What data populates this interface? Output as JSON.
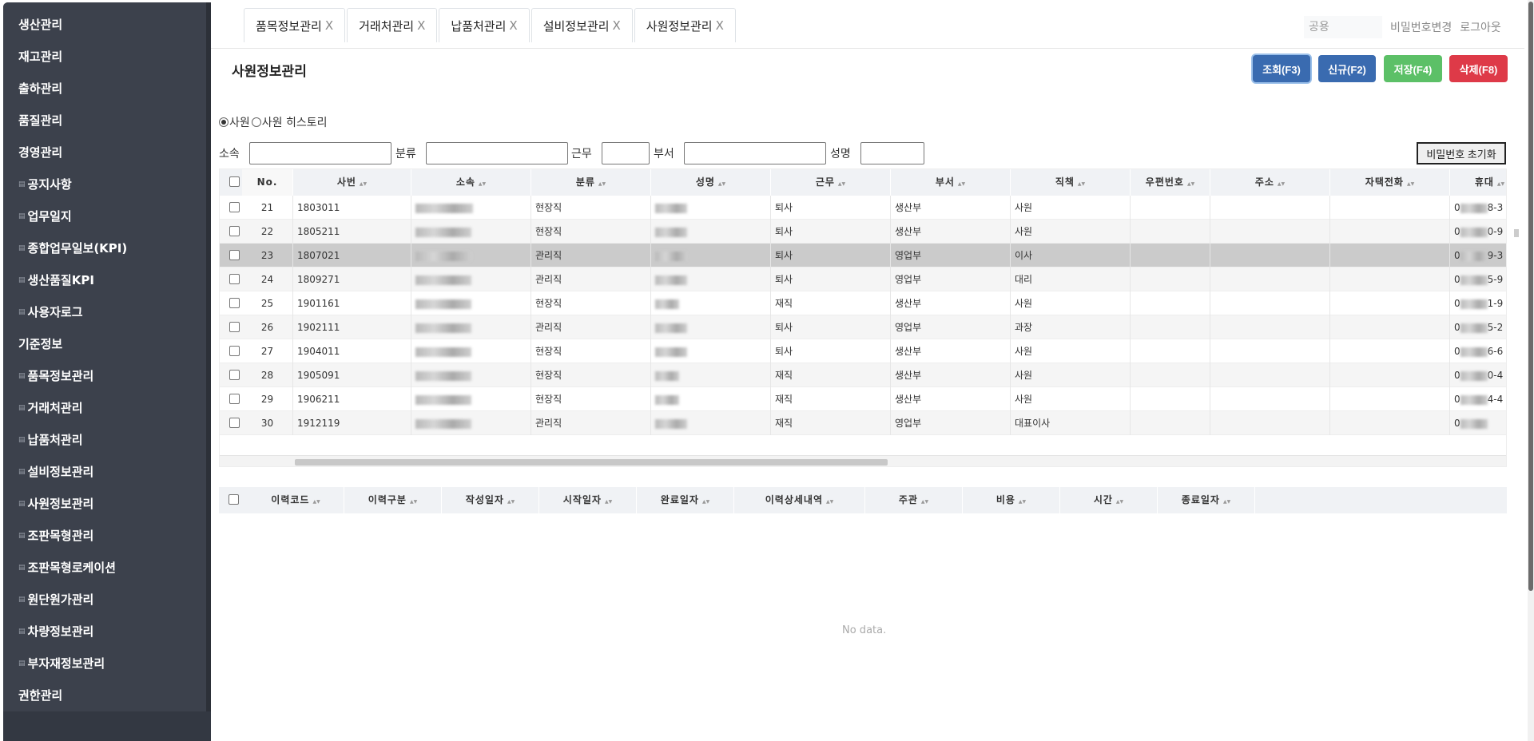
{
  "sidebar": {
    "items": [
      {
        "label": "생산관리",
        "sub": false
      },
      {
        "label": "재고관리",
        "sub": false
      },
      {
        "label": "출하관리",
        "sub": false
      },
      {
        "label": "품질관리",
        "sub": false
      },
      {
        "label": "경영관리",
        "sub": false
      },
      {
        "label": "공지사항",
        "sub": true
      },
      {
        "label": "업무일지",
        "sub": true
      },
      {
        "label": "종합업무일보(KPI)",
        "sub": true
      },
      {
        "label": "생산품질KPI",
        "sub": true
      },
      {
        "label": "사용자로그",
        "sub": true
      },
      {
        "label": "기준정보",
        "sub": false
      },
      {
        "label": "품목정보관리",
        "sub": true
      },
      {
        "label": "거래처관리",
        "sub": true
      },
      {
        "label": "납품처관리",
        "sub": true
      },
      {
        "label": "설비정보관리",
        "sub": true
      },
      {
        "label": "사원정보관리",
        "sub": true
      },
      {
        "label": "조판목형관리",
        "sub": true
      },
      {
        "label": "조판목형로케이션",
        "sub": true
      },
      {
        "label": "원단원가관리",
        "sub": true
      },
      {
        "label": "차량정보관리",
        "sub": true
      },
      {
        "label": "부자재정보관리",
        "sub": true
      },
      {
        "label": "권한관리",
        "sub": false
      }
    ],
    "sub_icon": "list-icon"
  },
  "tabs": [
    {
      "label": "품목정보관리",
      "close": "X"
    },
    {
      "label": "거래처관리",
      "close": "X"
    },
    {
      "label": "납품처관리",
      "close": "X"
    },
    {
      "label": "설비정보관리",
      "close": "X"
    },
    {
      "label": "사원정보관리",
      "close": "X"
    }
  ],
  "header": {
    "user": "공용",
    "change_password": "비밀번호변경",
    "logout": "로그아웃"
  },
  "page": {
    "title": "사원정보관리"
  },
  "toolbar": {
    "search": "조회(F3)",
    "new": "신규(F2)",
    "save": "저장(F4)",
    "delete": "삭제(F8)",
    "colors": {
      "search": "#3a6bb0",
      "new": "#3a6bb0",
      "save": "#5cc067",
      "delete": "#de3a48"
    }
  },
  "radios": [
    {
      "label": "사원",
      "checked": true
    },
    {
      "label": "사원 히스토리",
      "checked": false
    }
  ],
  "filters": {
    "affiliation": "소속",
    "category": "분류",
    "work": "근무",
    "dept": "부서",
    "name": "성명",
    "reset_password": "비밀번호 초기화"
  },
  "grid": {
    "columns": [
      "No.",
      "사번",
      "소속",
      "분류",
      "성명",
      "근무",
      "부서",
      "직책",
      "우편번호",
      "주소",
      "자택전화",
      "휴대"
    ],
    "rows": [
      {
        "no": "21",
        "id": "1803011",
        "cat": "현장직",
        "work": "퇴사",
        "dept": "생산부",
        "pos": "사원",
        "phone_tail": "8-3"
      },
      {
        "no": "22",
        "id": "1805211",
        "cat": "현장직",
        "work": "퇴사",
        "dept": "생산부",
        "pos": "사원",
        "phone_tail": "0-9"
      },
      {
        "no": "23",
        "id": "1807021",
        "cat": "관리직",
        "work": "퇴사",
        "dept": "영업부",
        "pos": "이사",
        "phone_tail": "9-3"
      },
      {
        "no": "24",
        "id": "1809271",
        "cat": "관리직",
        "work": "퇴사",
        "dept": "영업부",
        "pos": "대리",
        "phone_tail": "5-9"
      },
      {
        "no": "25",
        "id": "1901161",
        "cat": "현장직",
        "work": "재직",
        "dept": "생산부",
        "pos": "사원",
        "phone_tail": "1-9"
      },
      {
        "no": "26",
        "id": "1902111",
        "cat": "관리직",
        "work": "퇴사",
        "dept": "영업부",
        "pos": "과장",
        "phone_tail": "5-2"
      },
      {
        "no": "27",
        "id": "1904011",
        "cat": "현장직",
        "work": "퇴사",
        "dept": "생산부",
        "pos": "사원",
        "phone_tail": "6-6"
      },
      {
        "no": "28",
        "id": "1905091",
        "cat": "현장직",
        "work": "재직",
        "dept": "생산부",
        "pos": "사원",
        "phone_tail": "0-4"
      },
      {
        "no": "29",
        "id": "1906211",
        "cat": "현장직",
        "work": "재직",
        "dept": "생산부",
        "pos": "사원",
        "phone_tail": "4-4"
      },
      {
        "no": "30",
        "id": "1912119",
        "cat": "관리직",
        "work": "재직",
        "dept": "영업부",
        "pos": "대표이사",
        "phone_tail": ""
      }
    ],
    "selected_no": "23",
    "phone_prefix": "0"
  },
  "history": {
    "columns": [
      "이력코드",
      "이력구분",
      "작성일자",
      "시작일자",
      "완료일자",
      "이력상세내역",
      "주관",
      "비용",
      "시간",
      "종료일자"
    ],
    "empty": "No data."
  }
}
